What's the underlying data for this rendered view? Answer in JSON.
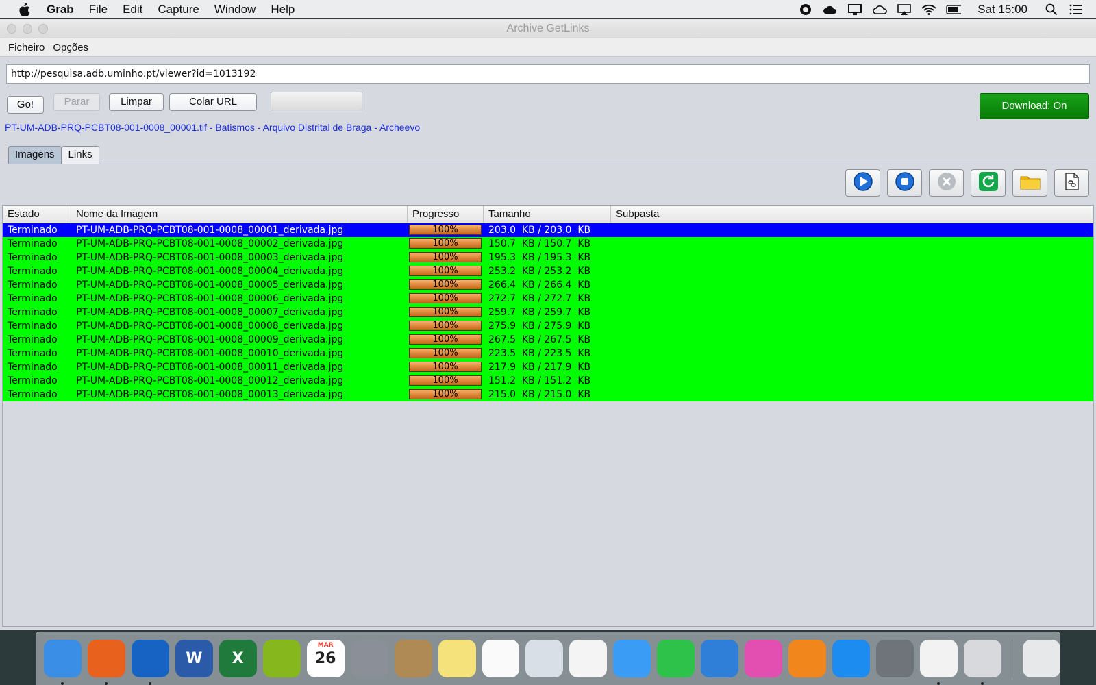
{
  "menubar": {
    "app": "Grab",
    "items": [
      "File",
      "Edit",
      "Capture",
      "Window",
      "Help"
    ],
    "clock": "Sat 15:00"
  },
  "window": {
    "title": "Archive GetLinks",
    "menu": [
      "Ficheiro",
      "Opções"
    ]
  },
  "url": {
    "value": "http://pesquisa.adb.uminho.pt/viewer?id=1013192"
  },
  "buttons": {
    "go": "Go!",
    "stop": "Parar",
    "clear": "Limpar",
    "paste": "Colar URL",
    "download": "Download: On"
  },
  "status_link": "PT-UM-ADB-PRQ-PCBT08-001-0008_00001.tif - Batismos - Arquivo Distrital de Braga - Archeevo",
  "tabs": [
    "Imagens",
    "Links"
  ],
  "toolbar_icons": [
    "play-icon",
    "stop-icon",
    "cancel-icon",
    "refresh-icon",
    "folder-icon",
    "document-link-icon"
  ],
  "table": {
    "headers": [
      "Estado",
      "Nome da Imagem",
      "Progresso",
      "Tamanho",
      "Subpasta"
    ],
    "rows": [
      {
        "estado": "Terminado",
        "nome": "PT-UM-ADB-PRQ-PCBT08-001-0008_00001_derivada.jpg",
        "progresso": "100%",
        "progress_value": 1.0,
        "tamanho": "203.0  KB / 203.0  KB",
        "subpasta": "",
        "selected": true
      },
      {
        "estado": "Terminado",
        "nome": "PT-UM-ADB-PRQ-PCBT08-001-0008_00002_derivada.jpg",
        "progresso": "100%",
        "progress_value": 1.0,
        "tamanho": "150.7  KB / 150.7  KB",
        "subpasta": ""
      },
      {
        "estado": "Terminado",
        "nome": "PT-UM-ADB-PRQ-PCBT08-001-0008_00003_derivada.jpg",
        "progresso": "100%",
        "progress_value": 1.0,
        "tamanho": "195.3  KB / 195.3  KB",
        "subpasta": ""
      },
      {
        "estado": "Terminado",
        "nome": "PT-UM-ADB-PRQ-PCBT08-001-0008_00004_derivada.jpg",
        "progresso": "100%",
        "progress_value": 1.0,
        "tamanho": "253.2  KB / 253.2  KB",
        "subpasta": ""
      },
      {
        "estado": "Terminado",
        "nome": "PT-UM-ADB-PRQ-PCBT08-001-0008_00005_derivada.jpg",
        "progresso": "100%",
        "progress_value": 1.0,
        "tamanho": "266.4  KB / 266.4  KB",
        "subpasta": ""
      },
      {
        "estado": "Terminado",
        "nome": "PT-UM-ADB-PRQ-PCBT08-001-0008_00006_derivada.jpg",
        "progresso": "100%",
        "progress_value": 1.0,
        "tamanho": "272.7  KB / 272.7  KB",
        "subpasta": ""
      },
      {
        "estado": "Terminado",
        "nome": "PT-UM-ADB-PRQ-PCBT08-001-0008_00007_derivada.jpg",
        "progresso": "100%",
        "progress_value": 1.0,
        "tamanho": "259.7  KB / 259.7  KB",
        "subpasta": ""
      },
      {
        "estado": "Terminado",
        "nome": "PT-UM-ADB-PRQ-PCBT08-001-0008_00008_derivada.jpg",
        "progresso": "100%",
        "progress_value": 1.0,
        "tamanho": "275.9  KB / 275.9  KB",
        "subpasta": ""
      },
      {
        "estado": "Terminado",
        "nome": "PT-UM-ADB-PRQ-PCBT08-001-0008_00009_derivada.jpg",
        "progresso": "100%",
        "progress_value": 1.0,
        "tamanho": "267.5  KB / 267.5  KB",
        "subpasta": ""
      },
      {
        "estado": "Terminado",
        "nome": "PT-UM-ADB-PRQ-PCBT08-001-0008_00010_derivada.jpg",
        "progresso": "100%",
        "progress_value": 1.0,
        "tamanho": "223.5  KB / 223.5  KB",
        "subpasta": ""
      },
      {
        "estado": "Terminado",
        "nome": "PT-UM-ADB-PRQ-PCBT08-001-0008_00011_derivada.jpg",
        "progresso": "100%",
        "progress_value": 1.0,
        "tamanho": "217.9  KB / 217.9  KB",
        "subpasta": ""
      },
      {
        "estado": "Terminado",
        "nome": "PT-UM-ADB-PRQ-PCBT08-001-0008_00012_derivada.jpg",
        "progresso": "100%",
        "progress_value": 1.0,
        "tamanho": "151.2  KB / 151.2  KB",
        "subpasta": ""
      },
      {
        "estado": "Terminado",
        "nome": "PT-UM-ADB-PRQ-PCBT08-001-0008_00013_derivada.jpg",
        "progresso": "100%",
        "progress_value": 1.0,
        "tamanho": "215.0  KB / 215.0  KB",
        "subpasta": ""
      }
    ]
  },
  "colors": {
    "row_done": "#00ff00",
    "row_selected": "#0000ff",
    "download_on": "#0b8f0b",
    "link": "#1c2de0"
  },
  "dock": {
    "apps": [
      {
        "name": "finder-icon",
        "color": "#3a8ee6",
        "running": true
      },
      {
        "name": "firefox-icon",
        "color": "#e8621d",
        "running": true
      },
      {
        "name": "outlook-icon",
        "color": "#1763c4",
        "running": true
      },
      {
        "name": "word-icon",
        "color": "#2b5aa8",
        "glyph": "W"
      },
      {
        "name": "excel-icon",
        "color": "#1f7a3c",
        "glyph": "X"
      },
      {
        "name": "tree-app-icon",
        "color": "#86b81e"
      },
      {
        "name": "calendar-icon",
        "color": "#ffffff",
        "glyph": "26",
        "dark": true,
        "sub": "MAR"
      },
      {
        "name": "launchpad-icon",
        "color": "#8a8f98"
      },
      {
        "name": "contacts-icon",
        "color": "#b08a55"
      },
      {
        "name": "notes-icon",
        "color": "#f6e27a"
      },
      {
        "name": "reminders-icon",
        "color": "#fafafa"
      },
      {
        "name": "preview-icon",
        "color": "#d9dfe6"
      },
      {
        "name": "photos-icon",
        "color": "#f4f4f4"
      },
      {
        "name": "messages-icon",
        "color": "#3b9cf5"
      },
      {
        "name": "facetime-icon",
        "color": "#2ec24a"
      },
      {
        "name": "keynote-icon",
        "color": "#2f7fd8"
      },
      {
        "name": "itunes-icon",
        "color": "#e24fb0"
      },
      {
        "name": "ibooks-icon",
        "color": "#f0861c"
      },
      {
        "name": "app-store-icon",
        "color": "#1d8cf0"
      },
      {
        "name": "system-preferences-icon",
        "color": "#6f737a"
      },
      {
        "name": "java-icon",
        "color": "#f2f2f2",
        "running": true
      },
      {
        "name": "grab-icon",
        "color": "#d7d9dc",
        "running": true
      },
      {
        "name": "trash-icon",
        "color": "#e6e8ea"
      }
    ]
  }
}
